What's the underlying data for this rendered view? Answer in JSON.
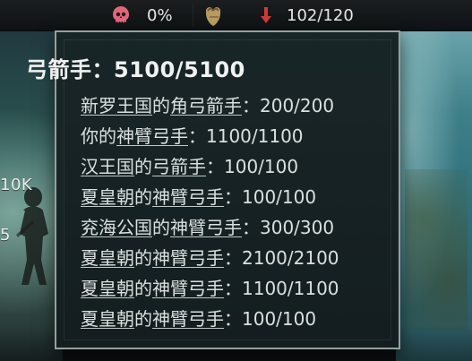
{
  "topbar": {
    "skull_percent": "0%",
    "manpower": "102/120"
  },
  "map": {
    "label_10k": "10K",
    "label_5": "5"
  },
  "tooltip": {
    "title": "弓箭手：5100/5100",
    "lines": [
      {
        "name_part1": "新罗王国",
        "conn": "的",
        "name_part2": "角弓箭手",
        "sep": "：",
        "value": "200/200"
      },
      {
        "name_part1": "你的",
        "conn": "",
        "name_part2": "神臂弓手",
        "sep": "：",
        "value": "1100/1100"
      },
      {
        "name_part1": "汉王国",
        "conn": "的",
        "name_part2": "弓箭手",
        "sep": "：",
        "value": "100/100"
      },
      {
        "name_part1": "夏皇朝",
        "conn": "的",
        "name_part2": "神臂弓手",
        "sep": "：",
        "value": "100/100"
      },
      {
        "name_part1": "兖海公国",
        "conn": "的",
        "name_part2": "神臂弓手",
        "sep": "：",
        "value": "300/300"
      },
      {
        "name_part1": "夏皇朝",
        "conn": "的",
        "name_part2": "神臂弓手",
        "sep": "：",
        "value": "2100/2100"
      },
      {
        "name_part1": "夏皇朝",
        "conn": "的",
        "name_part2": "神臂弓手",
        "sep": "：",
        "value": "1100/1100"
      },
      {
        "name_part1": "夏皇朝",
        "conn": "的",
        "name_part2": "神臂弓手",
        "sep": "：",
        "value": "100/100"
      }
    ]
  }
}
